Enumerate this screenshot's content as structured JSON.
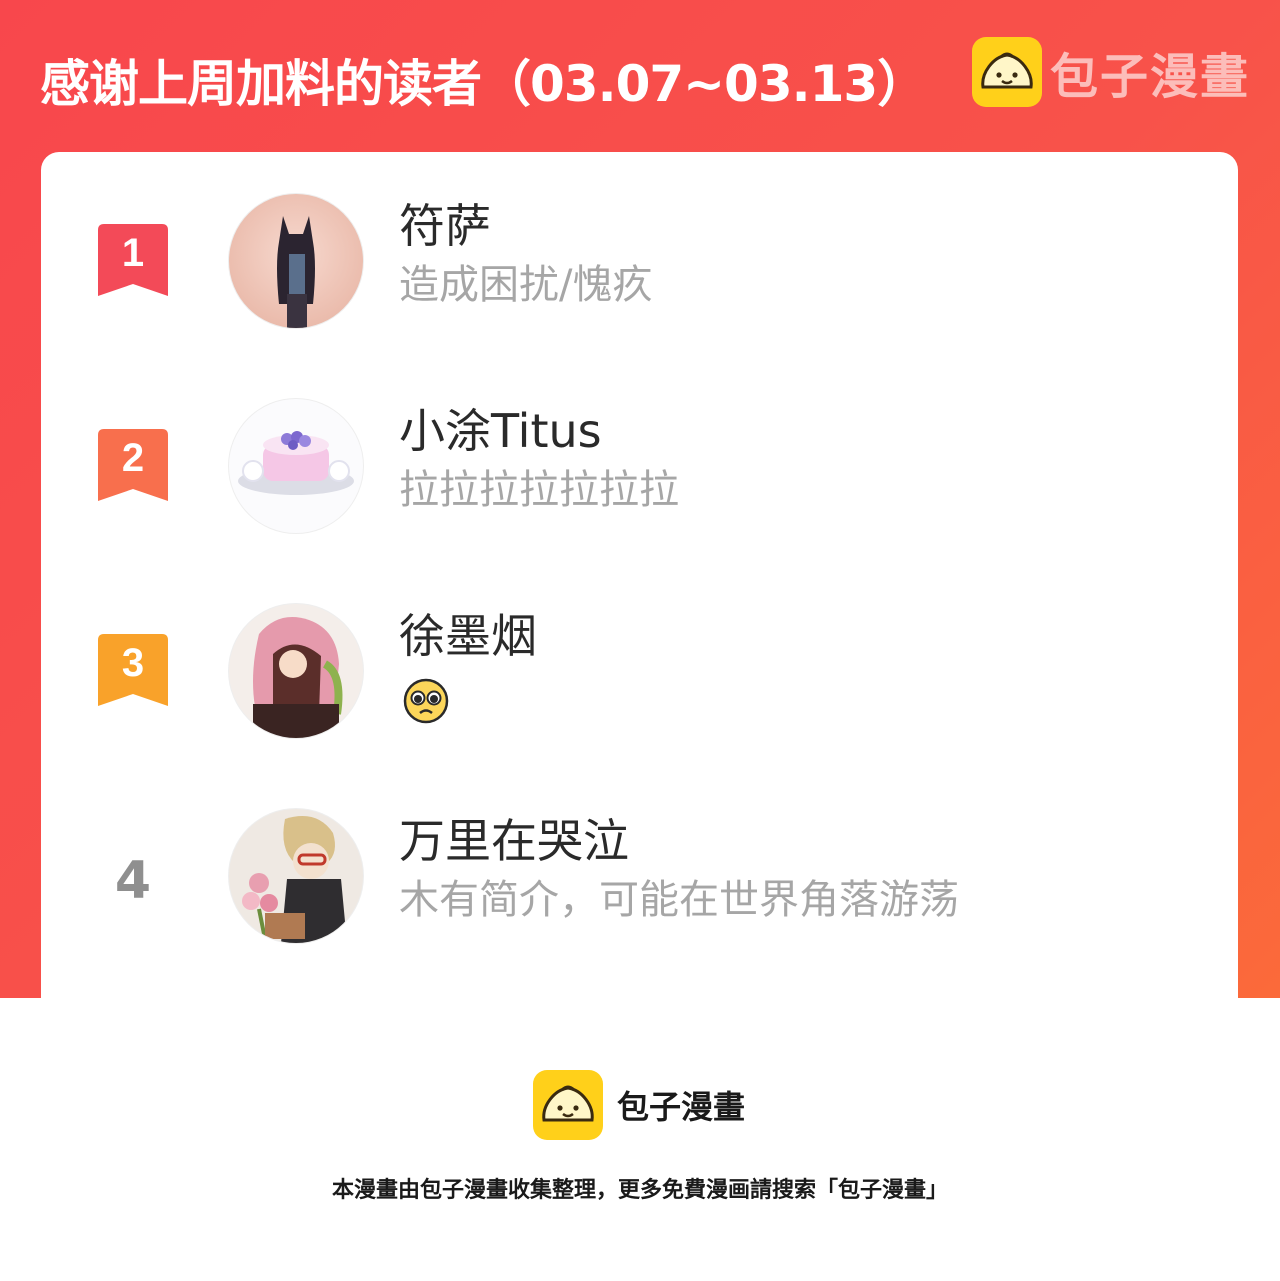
{
  "header": {
    "title": "感谢上周加料的读者（03.07~03.13）",
    "brand_name": "包子漫畫",
    "logo_icon": "steamed-bun-icon",
    "background": "#f8474c",
    "logo_color": "#ffd01a"
  },
  "ranking": [
    {
      "rank": "1",
      "name": "符萨",
      "bio": "造成困扰/愧疚",
      "badge_color": "#f34a58"
    },
    {
      "rank": "2",
      "name": "小涂Titus",
      "bio": "拉拉拉拉拉拉拉",
      "badge_color": "#f86f4d"
    },
    {
      "rank": "3",
      "name": "徐墨烟",
      "bio_icon": "pleading-face-emoji-icon",
      "badge_color": "#f9a22a"
    },
    {
      "rank": "4",
      "name": "万里在哭泣",
      "bio": "木有简介，可能在世界角落游荡"
    }
  ],
  "footer": {
    "brand_name": "包子漫畫",
    "note": "本漫畫由包子漫畫收集整理，更多免費漫画請搜索「包子漫畫」"
  }
}
